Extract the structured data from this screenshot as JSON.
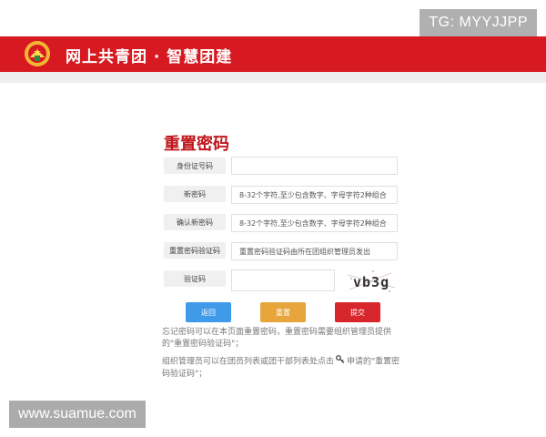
{
  "header": {
    "title": "网上共青团 · 智慧团建",
    "color": "#d71a21"
  },
  "page": {
    "title": "重置密码"
  },
  "form": {
    "id_number": {
      "label": "身份证号码",
      "value": "",
      "placeholder": ""
    },
    "new_password": {
      "label": "新密码",
      "value": "",
      "placeholder": "8-32个字符,至少包含数字、字母字符2种组合"
    },
    "confirm_password": {
      "label": "确认新密码",
      "value": "",
      "placeholder": "8-32个字符,至少包含数字、字母字符2种组合"
    },
    "reset_code": {
      "label": "重置密码验证码",
      "value": "",
      "placeholder": "重置密码验证码由所在团组织管理员发出"
    },
    "captcha": {
      "label": "验证码",
      "value": "",
      "placeholder": "",
      "image_text": "vb3g"
    }
  },
  "buttons": {
    "back": {
      "label": "返回",
      "color": "#3f9ae9"
    },
    "reset": {
      "label": "重置",
      "color": "#e8a53b"
    },
    "submit": {
      "label": "提交",
      "color": "#d7262c"
    }
  },
  "notes": {
    "line1": "忘记密码可以在本页面重置密码，重置密码需要组织管理员提供的\"重置密码验证码\"；",
    "line2_before": "组织管理员可以在团员列表或团干部列表处点击",
    "line2_icon": "key-icon",
    "line2_after": "申请的\"重置密码验证码\"；"
  },
  "watermarks": {
    "tg": "TG: MYYJJPP",
    "site": "www.suamue.com"
  }
}
